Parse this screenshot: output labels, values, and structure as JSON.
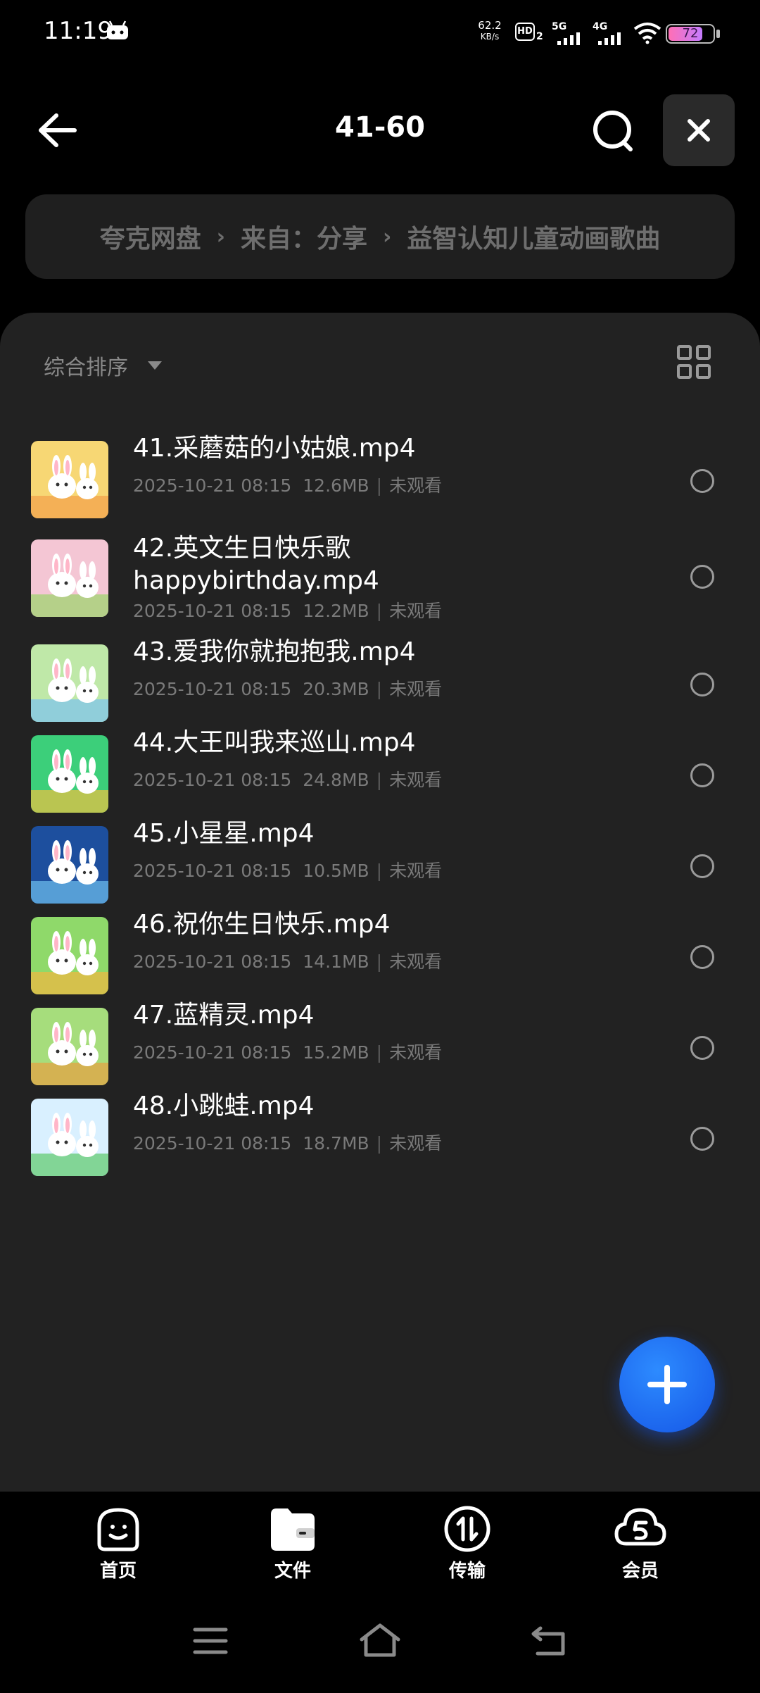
{
  "status_bar": {
    "time": "11:19",
    "net_speed_value": "62.2",
    "net_speed_unit": "KB/s",
    "hd_label": "HD",
    "hd_sub": "2",
    "sim1": "5G",
    "sim2": "4G",
    "battery": "72"
  },
  "header": {
    "title": "41-60"
  },
  "breadcrumb": [
    "夸克网盘",
    "来自：分享",
    "益智认知儿童动画歌曲"
  ],
  "sort": {
    "label": "综合排序"
  },
  "files": [
    {
      "name": "41.采蘑菇的小姑娘.mp4",
      "date": "2025-10-21 08:15",
      "size": "12.6MB",
      "status": "未观看",
      "thumb_color": "#f7d774",
      "accent": "#f2a04a"
    },
    {
      "name": "42.英文生日快乐歌 happybirthday.mp4",
      "date": "2025-10-21 08:15",
      "size": "12.2MB",
      "status": "未观看",
      "thumb_color": "#f4c6d4",
      "accent": "#9ad46a"
    },
    {
      "name": "43.爱我你就抱抱我.mp4",
      "date": "2025-10-21 08:15",
      "size": "20.3MB",
      "status": "未观看",
      "thumb_color": "#bfe8a8",
      "accent": "#7cc3f0"
    },
    {
      "name": "44.大王叫我来巡山.mp4",
      "date": "2025-10-21 08:15",
      "size": "24.8MB",
      "status": "未观看",
      "thumb_color": "#3ccf7a",
      "accent": "#f0c040"
    },
    {
      "name": "45.小星星.mp4",
      "date": "2025-10-21 08:15",
      "size": "10.5MB",
      "status": "未观看",
      "thumb_color": "#1d4f9e",
      "accent": "#6fc0ee"
    },
    {
      "name": "46.祝你生日快乐.mp4",
      "date": "2025-10-21 08:15",
      "size": "14.1MB",
      "status": "未观看",
      "thumb_color": "#8fd96a",
      "accent": "#f2b640"
    },
    {
      "name": "47.蓝精灵.mp4",
      "date": "2025-10-21 08:15",
      "size": "15.2MB",
      "status": "未观看",
      "thumb_color": "#a6dd7c",
      "accent": "#e8a040"
    },
    {
      "name": "48.小跳蛙.mp4",
      "date": "2025-10-21 08:15",
      "size": "18.7MB",
      "status": "未观看",
      "thumb_color": "#d9f0ff",
      "accent": "#5cc96a"
    }
  ],
  "tabs": [
    {
      "label": "首页",
      "icon": "home-face-icon"
    },
    {
      "label": "文件",
      "icon": "folder-icon"
    },
    {
      "label": "传输",
      "icon": "transfer-icon"
    },
    {
      "label": "会员",
      "icon": "cloud-member-icon"
    }
  ],
  "colors": {
    "background": "#000000",
    "panel": "#222222",
    "accent": "#1f6bff"
  }
}
